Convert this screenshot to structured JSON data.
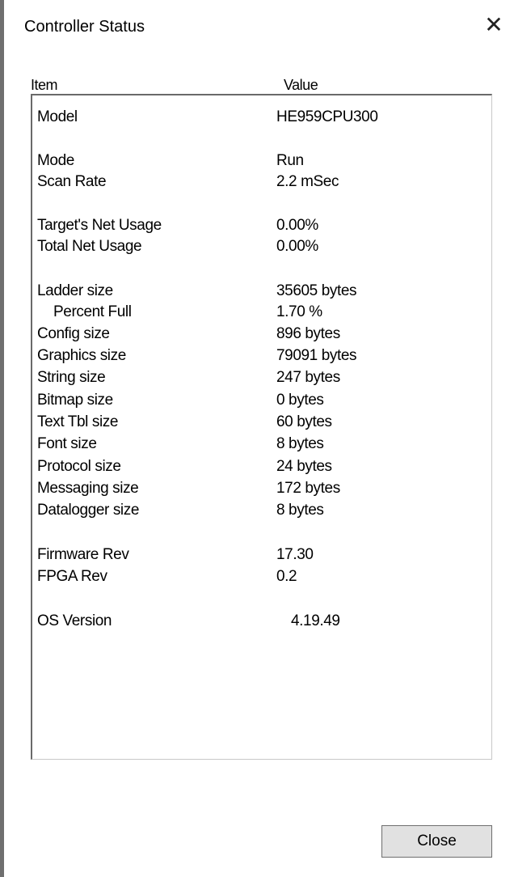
{
  "window": {
    "title": "Controller Status",
    "close_icon_glyph": "✕"
  },
  "list": {
    "headers": {
      "item": "Item",
      "value": "Value"
    },
    "rows": [
      {
        "label": "Model",
        "value": "HE959CPU300"
      },
      {
        "label": "Mode",
        "value": "Run"
      },
      {
        "label": "Scan Rate",
        "value": "2.2 mSec"
      },
      {
        "label": "Target's Net Usage",
        "value": "0.00%"
      },
      {
        "label": "Total Net Usage",
        "value": "0.00%"
      },
      {
        "label": "Ladder size",
        "value": "35605 bytes"
      },
      {
        "label": "Percent Full",
        "value": "1.70 %"
      },
      {
        "label": "Config size",
        "value": "896 bytes"
      },
      {
        "label": "Graphics size",
        "value": "79091 bytes"
      },
      {
        "label": "String size",
        "value": "247 bytes"
      },
      {
        "label": "Bitmap size",
        "value": "0 bytes"
      },
      {
        "label": "Text Tbl size",
        "value": "60 bytes"
      },
      {
        "label": "Font size",
        "value": "8 bytes"
      },
      {
        "label": "Protocol size",
        "value": "24 bytes"
      },
      {
        "label": "Messaging size",
        "value": "172 bytes"
      },
      {
        "label": "Datalogger size",
        "value": "8 bytes"
      },
      {
        "label": "Firmware Rev",
        "value": "17.30"
      },
      {
        "label": "FPGA Rev",
        "value": "0.2"
      },
      {
        "label": "OS Version",
        "value": "4.19.49"
      }
    ]
  },
  "buttons": {
    "close_label": "Close"
  }
}
